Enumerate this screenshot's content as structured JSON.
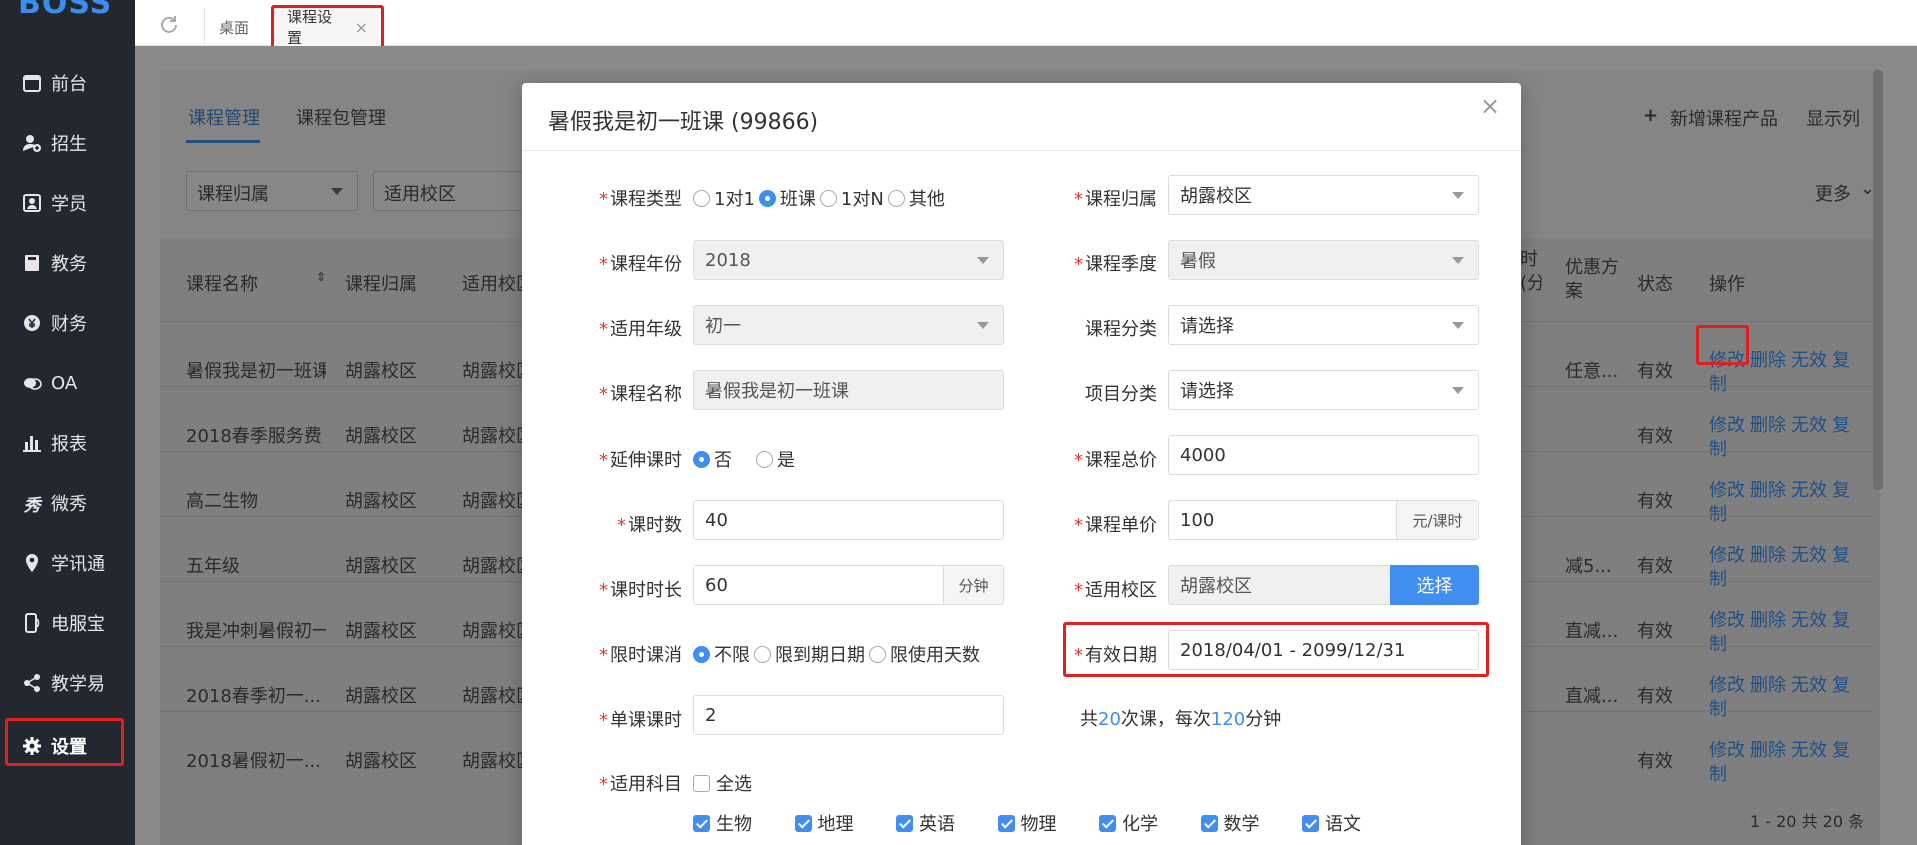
{
  "sidebar": {
    "logo": "BOSS",
    "items": [
      {
        "label": "前台",
        "icon": "calendar-icon"
      },
      {
        "label": "招生",
        "icon": "user-add-icon"
      },
      {
        "label": "学员",
        "icon": "student-card-icon"
      },
      {
        "label": "教务",
        "icon": "book-icon"
      },
      {
        "label": "财务",
        "icon": "yen-icon"
      },
      {
        "label": "OA",
        "icon": "chat-icon"
      },
      {
        "label": "报表",
        "icon": "bar-chart-icon"
      },
      {
        "label": "微秀",
        "icon": "show-icon"
      },
      {
        "label": "学讯通",
        "icon": "location-pin-icon"
      },
      {
        "label": "电服宝",
        "icon": "phone-icon"
      },
      {
        "label": "教学易",
        "icon": "share-icon"
      },
      {
        "label": "设置",
        "icon": "gear-icon"
      }
    ]
  },
  "topbar": {
    "tabs": [
      {
        "label": "桌面"
      },
      {
        "label": "课程设置",
        "close": "×"
      }
    ]
  },
  "page": {
    "tabs": [
      "课程管理",
      "课程包管理"
    ],
    "actions": {
      "add": "新增课程产品",
      "columns": "显示列",
      "more": "更多"
    },
    "filters": [
      "课程归属",
      "适用校区"
    ],
    "table": {
      "headers": [
        "课程名称",
        "课程归属",
        "适用校区",
        "时(分",
        "优惠方案",
        "状态",
        "操作"
      ],
      "rows": [
        {
          "name": "暑假我是初一班课",
          "owner": "胡露校区",
          "campus": "胡露校区",
          "discount": "任意...",
          "status": "有效"
        },
        {
          "name": "2018春季服务费",
          "owner": "胡露校区",
          "campus": "胡露校区",
          "discount": "",
          "status": "有效"
        },
        {
          "name": "高二生物",
          "owner": "胡露校区",
          "campus": "胡露校区",
          "discount": "",
          "status": "有效"
        },
        {
          "name": "五年级",
          "owner": "胡露校区",
          "campus": "胡露校区",
          "discount": "减5...",
          "status": "有效"
        },
        {
          "name": "我是冲刺暑假初一",
          "owner": "胡露校区",
          "campus": "胡露校区",
          "discount": "直减...",
          "status": "有效"
        },
        {
          "name": "2018春季初一...",
          "owner": "胡露校区",
          "campus": "胡露校区",
          "discount": "直减...",
          "status": "有效"
        },
        {
          "name": "2018暑假初一...",
          "owner": "胡露校区",
          "campus": "胡露校区",
          "discount": "",
          "status": "有效"
        }
      ],
      "row_actions": {
        "edit": "修改",
        "delete": "删除",
        "invalidate": "无效",
        "copy1": "复",
        "copy2": "制"
      }
    },
    "pagination": "1 - 20   共 20 条"
  },
  "modal": {
    "title": "暑假我是初一班课   (99866)",
    "close": "×",
    "fields": {
      "course_type": {
        "label": "课程类型",
        "options": [
          "1对1",
          "班课",
          "1对N",
          "其他"
        ],
        "selected": "班课"
      },
      "course_year": {
        "label": "课程年份",
        "value": "2018"
      },
      "grade": {
        "label": "适用年级",
        "value": "初一"
      },
      "course_name": {
        "label": "课程名称",
        "value": "暑假我是初一班课"
      },
      "extend": {
        "label": "延伸课时",
        "options": [
          "否",
          "是"
        ],
        "selected": "否"
      },
      "hours": {
        "label": "课时数",
        "value": "40"
      },
      "duration": {
        "label": "课时时长",
        "value": "60",
        "suffix": "分钟"
      },
      "limit": {
        "label": "限时课消",
        "options": [
          "不限",
          "限到期日期",
          "限使用天数"
        ],
        "selected": "不限"
      },
      "single_hours": {
        "label": "单课课时",
        "value": "2"
      },
      "subjects": {
        "label": "适用科目",
        "select_all": "全选",
        "items": [
          "生物",
          "地理",
          "英语",
          "物理",
          "化学",
          "数学",
          "语文"
        ]
      },
      "owner": {
        "label": "课程归属",
        "value": "胡露校区"
      },
      "season": {
        "label": "课程季度",
        "value": "暑假"
      },
      "category": {
        "label": "课程分类",
        "value": "请选择"
      },
      "project": {
        "label": "项目分类",
        "value": "请选择"
      },
      "total_price": {
        "label": "课程总价",
        "value": "4000"
      },
      "unit_price": {
        "label": "课程单价",
        "value": "100",
        "suffix": "元/课时"
      },
      "campus": {
        "label": "适用校区",
        "value": "胡露校区",
        "button": "选择"
      },
      "valid_date": {
        "label": "有效日期",
        "value": "2018/04/01 - 2099/12/31"
      },
      "summary": {
        "prefix": "共",
        "count": "20",
        "mid": "次课，每次",
        "minutes": "120",
        "suffix": "分钟"
      }
    }
  }
}
